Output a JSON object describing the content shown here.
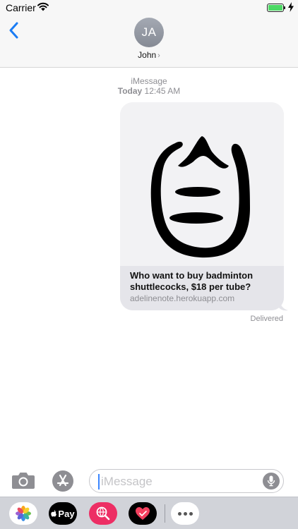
{
  "status_bar": {
    "carrier": "Carrier",
    "battery_level": 1.0,
    "battery_color": "#4cd964",
    "icons": [
      "wifi-icon",
      "battery-icon",
      "charging-bolt-icon"
    ]
  },
  "header": {
    "back_icon": "chevron-left-icon",
    "avatar_initials": "JA",
    "contact_name": "John",
    "contact_chevron": "›",
    "accent_color": "#1a7cf4"
  },
  "conversation": {
    "service": "iMessage",
    "day": "Today",
    "time": "12:45 AM",
    "message": {
      "type": "rich-link",
      "image_icon": "shuttlecock-logo-icon",
      "title": "Who want to buy badminton shuttlecocks, $18 per tube?",
      "domain": "adelinenote.herokuapp.com"
    },
    "status": "Delivered"
  },
  "input_bar": {
    "camera_icon": "camera-icon",
    "appstore_icon": "app-store-icon",
    "placeholder": "iMessage",
    "value": "",
    "mic_icon": "microphone-icon"
  },
  "app_drawer": {
    "apps": [
      {
        "name": "Photos",
        "icon": "photos-icon"
      },
      {
        "name": "Apple Pay",
        "icon": "apple-pay-icon",
        "label": "Pay"
      },
      {
        "name": "Search",
        "icon": "globe-search-icon"
      },
      {
        "name": "Digital Touch",
        "icon": "heart-icon"
      },
      {
        "name": "More",
        "icon": "more-icon"
      }
    ]
  }
}
